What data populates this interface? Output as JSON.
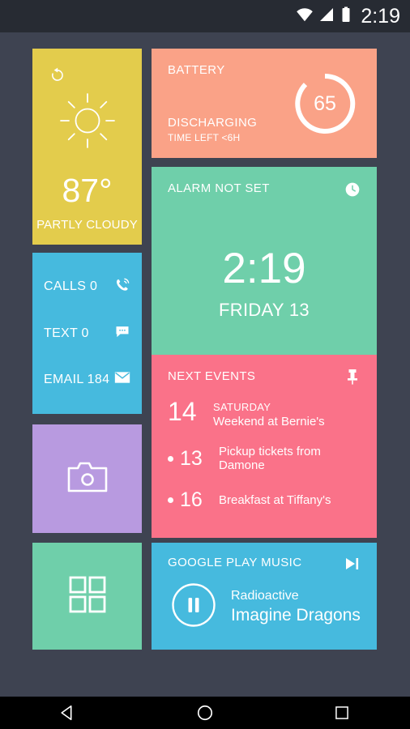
{
  "status_bar": {
    "wifi_icon": "wifi-icon",
    "signal_icon": "cell-signal-icon",
    "battery_icon": "battery-full-icon",
    "time": "2:19"
  },
  "widgets": {
    "weather": {
      "name": "weather-widget",
      "color": "#e3cc4c",
      "refresh_icon": "refresh-icon",
      "weather_icon": "sun-icon",
      "temperature": "87°",
      "condition": "PARTLY CLOUDY"
    },
    "battery": {
      "name": "battery-widget",
      "color": "#faa287",
      "title": "BATTERY",
      "state": "DISCHARGING",
      "subtitle": "TIME LEFT <6H",
      "percent": "65",
      "percent_value": 65
    },
    "clock": {
      "name": "clock-widget",
      "color": "#6fcfaa",
      "alarm_status": "ALARM NOT SET",
      "alarm_icon": "clock-icon",
      "time": "2:19",
      "date": "FRIDAY 13"
    },
    "comms": {
      "name": "communications-widget",
      "color": "#46bade",
      "rows": [
        {
          "label": "CALLS 0",
          "icon": "phone-icon"
        },
        {
          "label": "TEXT 0",
          "icon": "message-bubble-icon"
        },
        {
          "label": "EMAIL 184",
          "icon": "envelope-icon"
        }
      ]
    },
    "events": {
      "name": "next-events-widget",
      "color": "#fa7289",
      "title": "NEXT EVENTS",
      "pin_icon": "pushpin-icon",
      "featured": {
        "day": "14",
        "weekday": "SATURDAY",
        "description": "Weekend at Bernie's"
      },
      "list": [
        {
          "day": "13",
          "description": "Pickup tickets from Damone"
        },
        {
          "day": "16",
          "description": "Breakfast at Tiffany's"
        }
      ]
    },
    "camera": {
      "name": "camera-shortcut-widget",
      "color": "#b89ae0",
      "icon": "camera-icon"
    },
    "apps": {
      "name": "app-drawer-widget",
      "color": "#6fcfaa",
      "icon": "app-grid-icon"
    },
    "music": {
      "name": "music-player-widget",
      "color": "#46bade",
      "title": "GOOGLE PLAY MUSIC",
      "next_icon": "skip-next-icon",
      "play_pause_icon": "pause-icon",
      "track": "Radioactive",
      "artist": "Imagine Dragons"
    }
  },
  "nav_bar": {
    "back": "back-icon",
    "home": "home-icon",
    "recents": "recents-icon"
  }
}
